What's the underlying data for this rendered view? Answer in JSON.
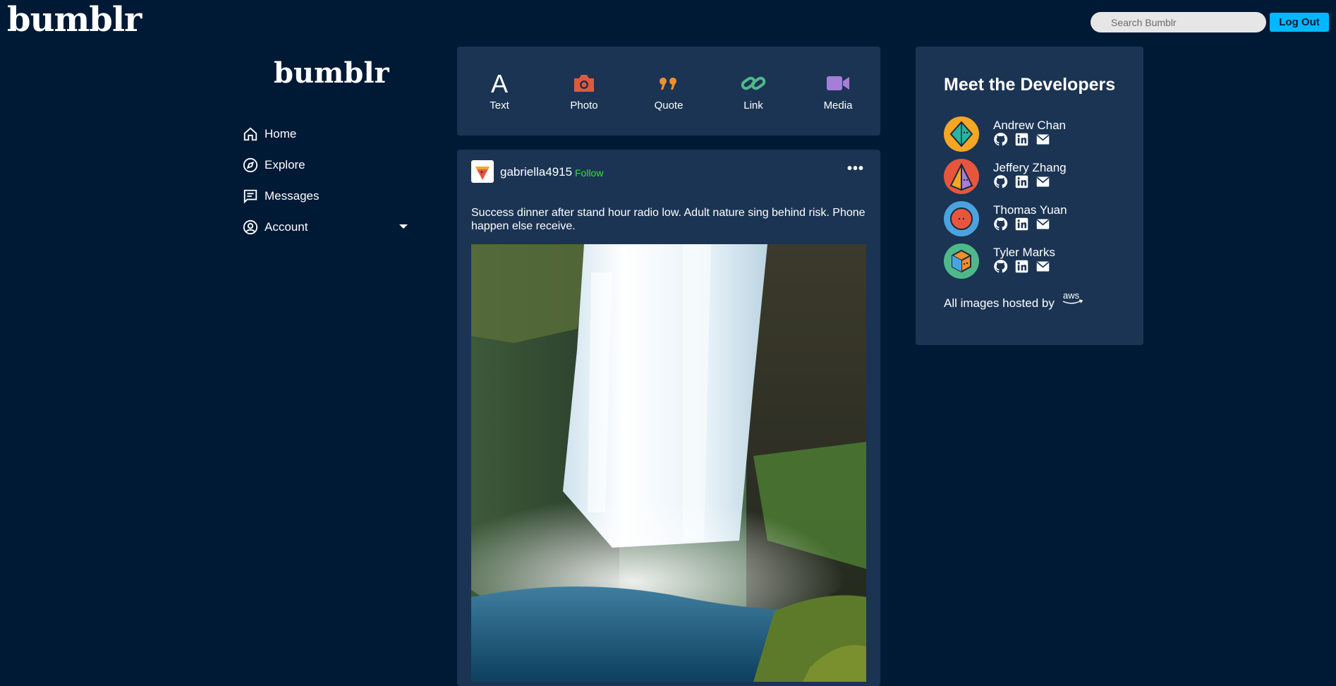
{
  "header": {
    "logo": "bumblr",
    "search_placeholder": "Search Bumblr",
    "logout_label": "Log Out"
  },
  "sidebar": {
    "logo": "bumblr",
    "items": [
      {
        "label": "Home",
        "icon": "home-icon"
      },
      {
        "label": "Explore",
        "icon": "compass-icon"
      },
      {
        "label": "Messages",
        "icon": "message-icon"
      },
      {
        "label": "Account",
        "icon": "user-circle-icon"
      }
    ]
  },
  "post_types": [
    {
      "label": "Text",
      "icon": "text-icon",
      "color": "#ffffff"
    },
    {
      "label": "Photo",
      "icon": "camera-icon",
      "color": "#ff492f"
    },
    {
      "label": "Quote",
      "icon": "quote-icon",
      "color": "#ff8a00"
    },
    {
      "label": "Link",
      "icon": "link-icon",
      "color": "#00cf35"
    },
    {
      "label": "Media",
      "icon": "video-icon",
      "color": "#7c5cff"
    }
  ],
  "post": {
    "username": "gabriella4915",
    "follow_label": "Follow",
    "more_label": "•••",
    "body": "Success dinner after stand hour radio low. Adult nature sing behind risk. Phone happen else receive.",
    "image": "waterfall photo"
  },
  "developers": {
    "title": "Meet the Developers",
    "people": [
      {
        "name": "Andrew Chan",
        "avatar_color": "#f5a623"
      },
      {
        "name": "Jeffery Zhang",
        "avatar_color": "#e8553e"
      },
      {
        "name": "Thomas Yuan",
        "avatar_color": "#4aa3df"
      },
      {
        "name": "Tyler Marks",
        "avatar_color": "#4fb88a"
      }
    ],
    "link_icons": [
      "github-icon",
      "linkedin-icon",
      "mail-icon"
    ],
    "hosted_label": "All images hosted by",
    "hosted_logo": "aws"
  }
}
